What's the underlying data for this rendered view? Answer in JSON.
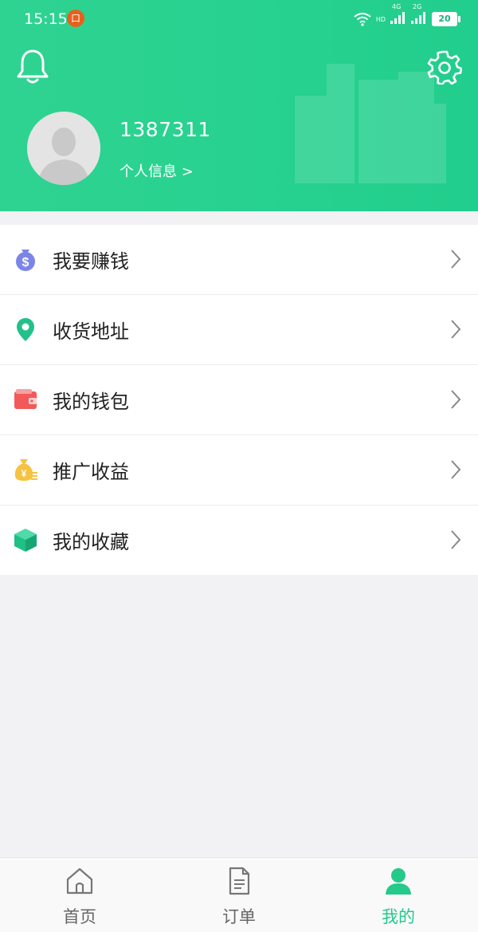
{
  "status_bar": {
    "time": "15:15",
    "notification_badge": "口",
    "network_labels": [
      "HD",
      "4G",
      "2G"
    ],
    "battery": "20"
  },
  "header": {
    "username": "1387311",
    "profile_link": "个人信息 >",
    "bell_icon": "bell-icon",
    "settings_icon": "gear-icon",
    "avatar_icon": "default-avatar"
  },
  "menu": {
    "items": [
      {
        "label": "我要赚钱",
        "icon": "money-bag-icon",
        "color": "#7b85e8"
      },
      {
        "label": "收货地址",
        "icon": "location-pin-icon",
        "color": "#23c08a"
      },
      {
        "label": "我的钱包",
        "icon": "wallet-icon",
        "color": "#f25a5a"
      },
      {
        "label": "推广收益",
        "icon": "yuan-bag-icon",
        "color": "#f5c242"
      },
      {
        "label": "我的收藏",
        "icon": "box-icon",
        "color": "#1fbf86"
      }
    ]
  },
  "tabbar": {
    "tabs": [
      {
        "label": "首页",
        "icon": "home-icon",
        "active": false
      },
      {
        "label": "订单",
        "icon": "document-icon",
        "active": false
      },
      {
        "label": "我的",
        "icon": "person-icon",
        "active": true
      }
    ]
  },
  "colors": {
    "brand": "#27d18f",
    "active_tab": "#25c98a",
    "background": "#f2f2f4"
  }
}
